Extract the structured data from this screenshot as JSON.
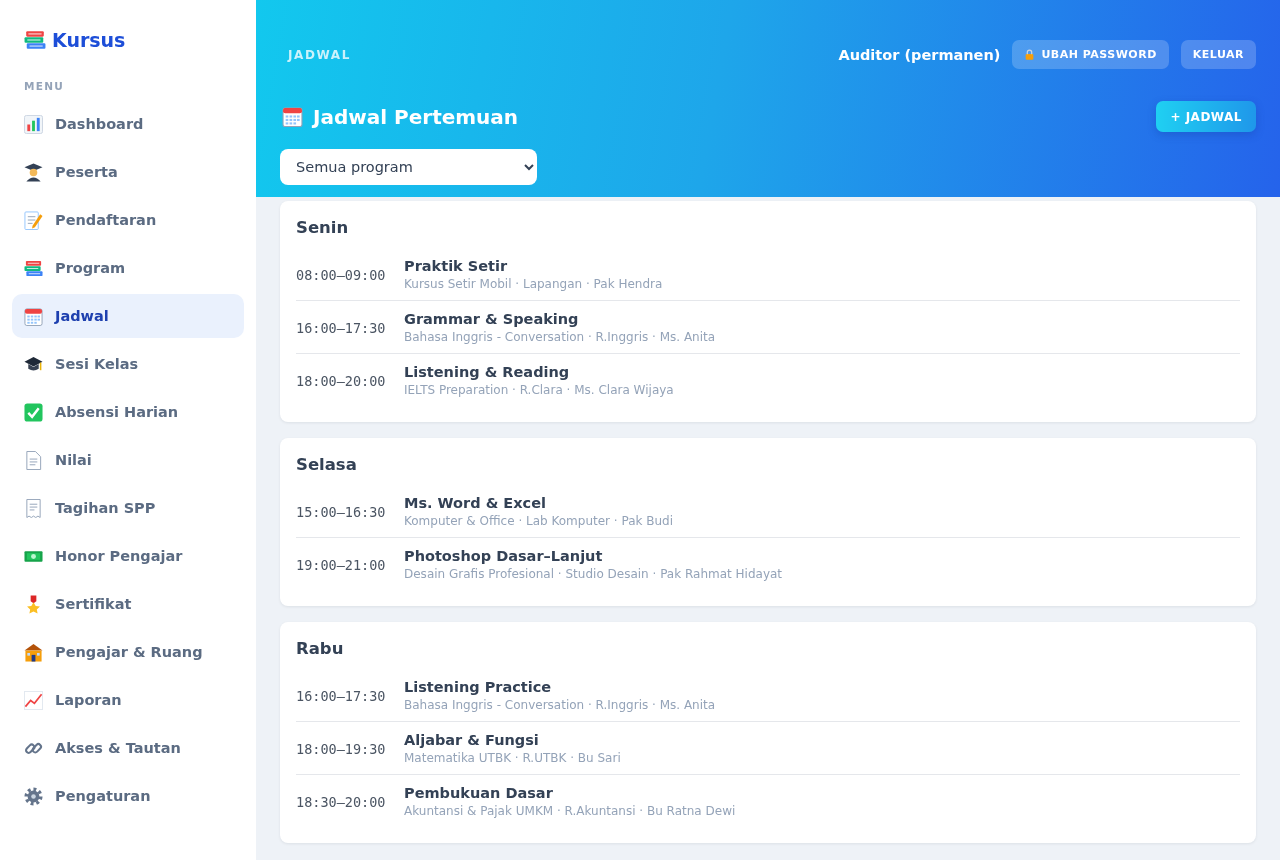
{
  "sidebar": {
    "brand": "Kursus",
    "section_label": "MENU",
    "items": [
      {
        "label": "Dashboard",
        "selected": false
      },
      {
        "label": "Peserta",
        "selected": false
      },
      {
        "label": "Pendaftaran",
        "selected": false
      },
      {
        "label": "Program",
        "selected": false
      },
      {
        "label": "Jadwal",
        "selected": true
      },
      {
        "label": "Sesi Kelas",
        "selected": false
      },
      {
        "label": "Absensi Harian",
        "selected": false
      },
      {
        "label": "Nilai",
        "selected": false
      },
      {
        "label": "Tagihan SPP",
        "selected": false
      },
      {
        "label": "Honor Pengajar",
        "selected": false
      },
      {
        "label": "Sertifikat",
        "selected": false
      },
      {
        "label": "Pengajar & Ruang",
        "selected": false
      },
      {
        "label": "Laporan",
        "selected": false
      },
      {
        "label": "Akses & Tautan",
        "selected": false
      },
      {
        "label": "Pengaturan",
        "selected": false
      }
    ]
  },
  "header": {
    "breadcrumb": "JADWAL",
    "user": "Auditor (permanen)",
    "buttons": [
      {
        "label": "UBAH PASSWORD",
        "kind": "password"
      },
      {
        "label": "KELUAR",
        "kind": "logout"
      }
    ],
    "title": "Jadwal Pertemuan",
    "add_button": "+ JADWAL",
    "filter": {
      "value": "Semua program"
    }
  },
  "days": [
    {
      "day": "Senin",
      "sessions": [
        {
          "time": "08:00–09:00",
          "title": "Praktik Setir",
          "details": "Kursus Setir Mobil · Lapangan · Pak Hendra"
        },
        {
          "time": "16:00–17:30",
          "title": "Grammar & Speaking",
          "details": "Bahasa Inggris - Conversation · R.Inggris · Ms. Anita"
        },
        {
          "time": "18:00–20:00",
          "title": "Listening & Reading",
          "details": "IELTS Preparation · R.Clara · Ms. Clara Wijaya"
        }
      ]
    },
    {
      "day": "Selasa",
      "sessions": [
        {
          "time": "15:00–16:30",
          "title": "Ms. Word & Excel",
          "details": "Komputer & Office · Lab Komputer · Pak Budi"
        },
        {
          "time": "19:00–21:00",
          "title": "Photoshop Dasar–Lanjut",
          "details": "Desain Grafis Profesional · Studio Desain · Pak Rahmat Hidayat"
        }
      ]
    },
    {
      "day": "Rabu",
      "sessions": [
        {
          "time": "16:00–17:30",
          "title": "Listening Practice",
          "details": "Bahasa Inggris - Conversation · R.Inggris · Ms. Anita"
        },
        {
          "time": "18:00–19:30",
          "title": "Aljabar & Fungsi",
          "details": "Matematika UTBK · R.UTBK · Bu Sari"
        },
        {
          "time": "18:30–20:00",
          "title": "Pembukuan Dasar",
          "details": "Akuntansi & Pajak UMKM · R.Akuntansi · Bu Ratna Dewi"
        }
      ]
    }
  ]
}
